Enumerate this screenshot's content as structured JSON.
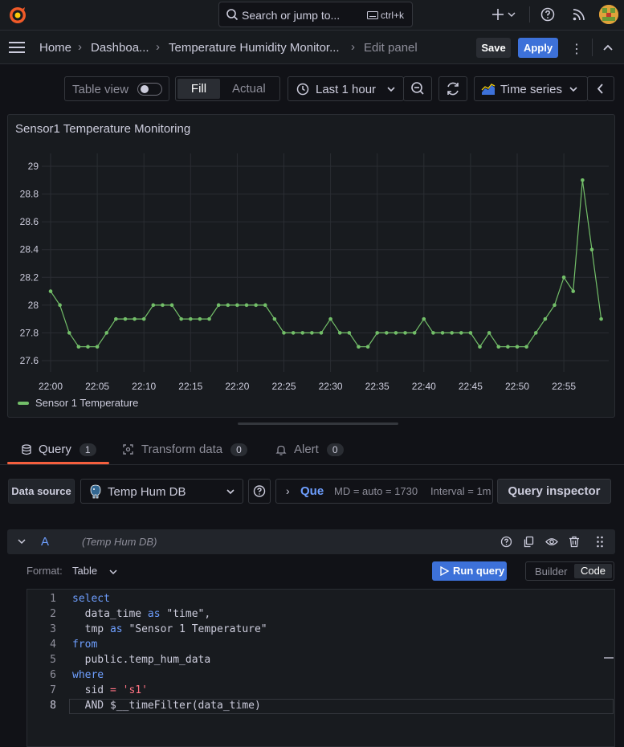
{
  "topbar": {
    "search_placeholder": "Search or jump to...",
    "search_shortcut": "ctrl+k"
  },
  "breadcrumb": {
    "home": "Home",
    "dashboards": "Dashboa...",
    "dashboard": "Temperature Humidity Monitor...",
    "current": "Edit panel",
    "save": "Save",
    "apply": "Apply"
  },
  "toolbar": {
    "table_view": "Table view",
    "fill": "Fill",
    "actual": "Actual",
    "time_range": "Last 1 hour",
    "visualization": "Time series"
  },
  "panel": {
    "title": "Sensor1 Temperature Monitoring",
    "legend": "Sensor 1 Temperature"
  },
  "chart_data": {
    "type": "line",
    "title": "Sensor1 Temperature Monitoring",
    "xlabel": "",
    "ylabel": "",
    "x_ticks": [
      "22:00",
      "22:05",
      "22:10",
      "22:15",
      "22:20",
      "22:25",
      "22:30",
      "22:35",
      "22:40",
      "22:45",
      "22:50",
      "22:55"
    ],
    "y_ticks": [
      "27.6",
      "27.8",
      "28",
      "28.2",
      "28.4",
      "28.6",
      "28.8",
      "29"
    ],
    "ylim": [
      27.6,
      29.0
    ],
    "grid": true,
    "legend_position": "bottom-left",
    "color": "#73bf69",
    "series": [
      {
        "name": "Sensor 1 Temperature",
        "x": [
          "22:00",
          "22:01",
          "22:02",
          "22:03",
          "22:04",
          "22:05",
          "22:06",
          "22:07",
          "22:08",
          "22:09",
          "22:10",
          "22:11",
          "22:12",
          "22:13",
          "22:14",
          "22:15",
          "22:16",
          "22:17",
          "22:18",
          "22:19",
          "22:20",
          "22:21",
          "22:22",
          "22:23",
          "22:24",
          "22:25",
          "22:26",
          "22:27",
          "22:28",
          "22:29",
          "22:30",
          "22:31",
          "22:32",
          "22:33",
          "22:34",
          "22:35",
          "22:36",
          "22:37",
          "22:38",
          "22:39",
          "22:40",
          "22:41",
          "22:42",
          "22:43",
          "22:44",
          "22:45",
          "22:46",
          "22:47",
          "22:48",
          "22:49",
          "22:50",
          "22:51",
          "22:52",
          "22:53",
          "22:54",
          "22:55",
          "22:56",
          "22:57",
          "22:58",
          "22:59"
        ],
        "values": [
          28.1,
          28.0,
          27.8,
          27.7,
          27.7,
          27.7,
          27.8,
          27.9,
          27.9,
          27.9,
          27.9,
          28.0,
          28.0,
          28.0,
          27.9,
          27.9,
          27.9,
          27.9,
          28.0,
          28.0,
          28.0,
          28.0,
          28.0,
          28.0,
          27.9,
          27.8,
          27.8,
          27.8,
          27.8,
          27.8,
          27.9,
          27.8,
          27.8,
          27.7,
          27.7,
          27.8,
          27.8,
          27.8,
          27.8,
          27.8,
          27.9,
          27.8,
          27.8,
          27.8,
          27.8,
          27.8,
          27.7,
          27.8,
          27.7,
          27.7,
          27.7,
          27.7,
          27.8,
          27.9,
          28.0,
          28.2,
          28.1,
          28.9,
          28.4,
          27.9
        ]
      }
    ]
  },
  "tabs": [
    {
      "label": "Query",
      "count": "1"
    },
    {
      "label": "Transform data",
      "count": "0"
    },
    {
      "label": "Alert",
      "count": "0"
    }
  ],
  "datasource": {
    "label": "Data source",
    "value": "Temp Hum DB",
    "query_options_label": "Que",
    "md": "MD = auto = 1730",
    "interval": "Interval = 1m",
    "inspector": "Query inspector"
  },
  "query": {
    "ref_id": "A",
    "ds_name": "(Temp Hum DB)",
    "format_label": "Format:",
    "format_value": "Table",
    "run": "Run query",
    "builder": "Builder",
    "code": "Code"
  },
  "sql": {
    "l1": "select",
    "l2a": "  data_time ",
    "l2b": "as",
    "l2c": " \"time\",",
    "l3a": "  tmp ",
    "l3b": "as",
    "l3c": " \"Sensor 1 Temperature\"",
    "l4": "from",
    "l5": "  public.temp_hum_data",
    "l6": "where",
    "l7a": "  sid ",
    "l7b": "=",
    "l7c": " 's1'",
    "l8": "  AND $__timeFilter(data_time)"
  },
  "line_numbers": [
    "1",
    "2",
    "3",
    "4",
    "5",
    "6",
    "7",
    "8"
  ]
}
